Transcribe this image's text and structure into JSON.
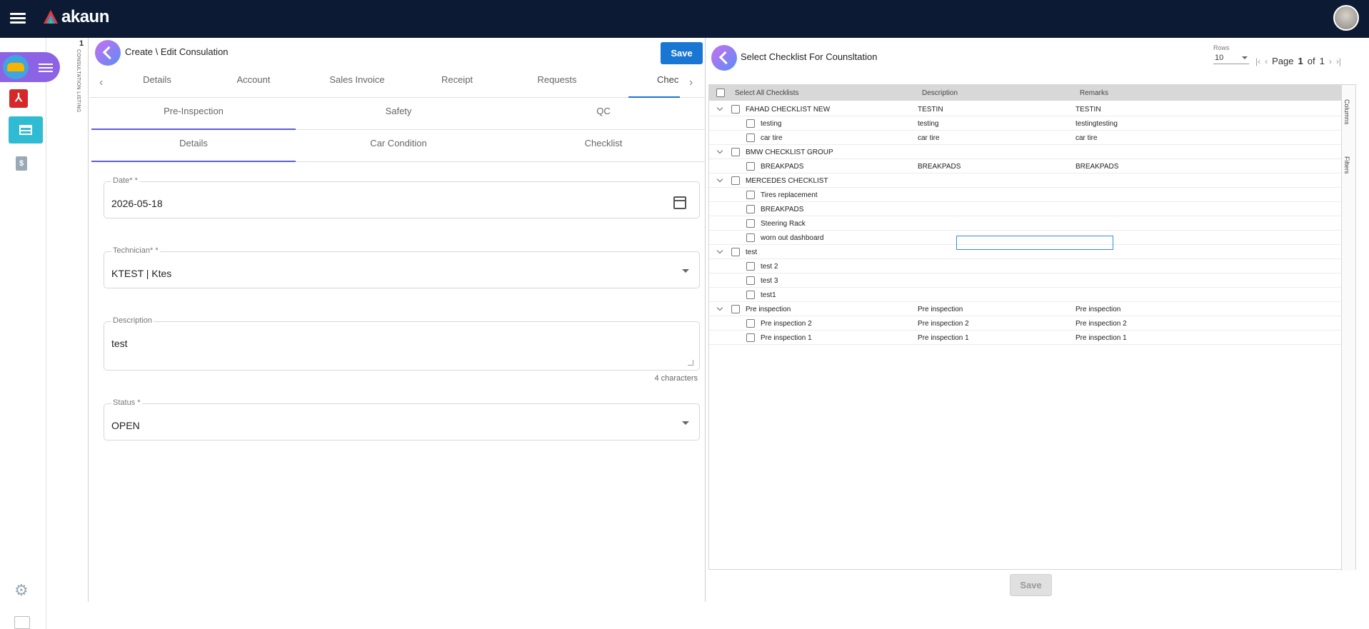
{
  "brand": {
    "name": "akaun"
  },
  "left_panel": {
    "title": "Create \\ Edit Consulation",
    "save_label": "Save",
    "main_tabs": [
      "Details",
      "Account",
      "Sales Invoice",
      "Receipt",
      "Requests",
      "Chec"
    ],
    "sub_tabs": [
      "Pre-Inspection",
      "Safety",
      "QC"
    ],
    "detail_tabs": [
      "Details",
      "Car Condition",
      "Checklist"
    ],
    "fields": {
      "date": {
        "label": "Date* *",
        "value": "2026-05-18"
      },
      "technician": {
        "label": "Technician* *",
        "value": "KTEST | Ktes"
      },
      "description": {
        "label": "Description",
        "value": "test",
        "count": "4 characters"
      },
      "status": {
        "label": "Status *",
        "value": "OPEN"
      }
    }
  },
  "listing": {
    "number": "1",
    "label": "CONSULTATION LISTING"
  },
  "right_panel": {
    "title": "Select Checklist For Counsltation",
    "rows_label": "Rows",
    "rows_value": "10",
    "page_word": "Page",
    "page_num": "1",
    "of_word": "of",
    "page_total": "1",
    "columns": {
      "select_all": "Select All Checklists",
      "description": "Description",
      "remarks": "Remarks"
    },
    "side_tabs": [
      "Columns",
      "Filters"
    ],
    "save_label": "Save",
    "rows": [
      {
        "group": true,
        "name": "FAHAD CHECKLIST NEW",
        "desc": "TESTIN",
        "remarks": "TESTIN"
      },
      {
        "group": false,
        "name": "testing",
        "desc": "testing",
        "remarks": "testingtesting"
      },
      {
        "group": false,
        "name": "car tire",
        "desc": "car tire",
        "remarks": "car tire"
      },
      {
        "group": true,
        "name": "BMW CHECKLIST GROUP",
        "desc": "",
        "remarks": ""
      },
      {
        "group": false,
        "name": "BREAKPADS",
        "desc": "BREAKPADS",
        "remarks": "BREAKPADS"
      },
      {
        "group": true,
        "name": "MERCEDES CHECKLIST",
        "desc": "",
        "remarks": ""
      },
      {
        "group": false,
        "name": "Tires replacement",
        "desc": "",
        "remarks": ""
      },
      {
        "group": false,
        "name": "BREAKPADS",
        "desc": "",
        "remarks": ""
      },
      {
        "group": false,
        "name": "Steering Rack",
        "desc": "",
        "remarks": ""
      },
      {
        "group": false,
        "name": "worn out dashboard",
        "desc": "",
        "remarks": ""
      },
      {
        "group": true,
        "name": "test",
        "desc": "",
        "remarks": ""
      },
      {
        "group": false,
        "name": "test 2",
        "desc": "",
        "remarks": ""
      },
      {
        "group": false,
        "name": "test 3",
        "desc": "",
        "remarks": ""
      },
      {
        "group": false,
        "name": "test1",
        "desc": "",
        "remarks": ""
      },
      {
        "group": true,
        "name": "Pre inspection",
        "desc": "Pre inspection",
        "remarks": "Pre inspection"
      },
      {
        "group": false,
        "name": "Pre inspection 2",
        "desc": "Pre inspection 2",
        "remarks": "Pre inspection 2"
      },
      {
        "group": false,
        "name": "Pre inspection 1",
        "desc": "Pre inspection 1",
        "remarks": "Pre inspection 1"
      }
    ]
  }
}
